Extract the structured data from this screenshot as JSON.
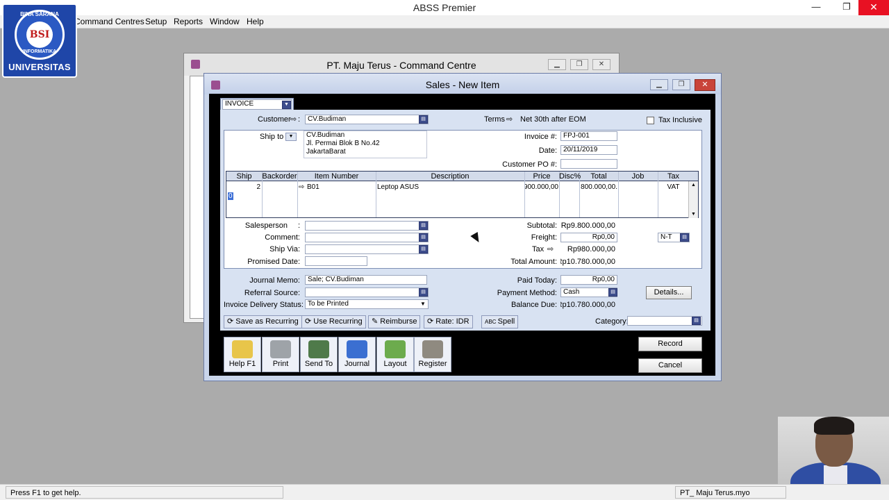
{
  "app": {
    "title": "ABSS Premier",
    "min": "—",
    "restore": "❐",
    "close": "✕"
  },
  "menu": [
    "Command Centres",
    "Setup",
    "Reports",
    "Window",
    "Help"
  ],
  "logo": {
    "arc_top": "BINA SARANA",
    "arc_bottom": "INFORMATIKA",
    "mark": "BSI",
    "label": "UNIVERSITAS"
  },
  "command_centre": {
    "title": "PT. Maju Terus - Command Centre"
  },
  "sales": {
    "title": "Sales - New Item",
    "layout_type": "INVOICE",
    "customer_label": "Customer",
    "customer": "CV.Budiman",
    "terms_label": "Terms",
    "terms": "Net 30th after EOM",
    "tax_inclusive_label": "Tax Inclusive",
    "ship_to_label": "Ship to",
    "ship_to_lines": [
      "CV.Budiman",
      "Jl. Permai Blok B No.42",
      "JakartaBarat"
    ],
    "invoice_no_label": "Invoice #:",
    "invoice_no": "FPJ-001",
    "date_label": "Date:",
    "date": "20/11/2019",
    "customer_po_label": "Customer PO #:",
    "customer_po": "",
    "grid": {
      "headers": [
        "Ship",
        "Backorder",
        "Item Number",
        "Description",
        "Price",
        "Disc%",
        "Total",
        "Job",
        "Tax"
      ],
      "row": {
        "ship": "2",
        "backorder": "",
        "item": "B01",
        "description": "Leptop ASUS",
        "price": "900.000,00",
        "disc": "",
        "total": ".800.000,00",
        "job": "",
        "tax": "VAT"
      },
      "next_ship": "0"
    },
    "salesperson_label": "Salesperson",
    "comment_label": "Comment:",
    "ship_via_label": "Ship Via:",
    "promised_date_label": "Promised Date:",
    "subtotal_label": "Subtotal:",
    "subtotal": "Rp9.800.000,00",
    "freight_label": "Freight:",
    "freight": "Rp0,00",
    "freight_tax": "N-T",
    "tax_label": "Tax",
    "tax": "Rp980.000,00",
    "total_label": "Total Amount:",
    "total": "Rp10.780.000,00",
    "journal_memo_label": "Journal Memo:",
    "journal_memo": "Sale; CV.Budiman",
    "referral_label": "Referral Source:",
    "delivery_label": "Invoice Delivery Status:",
    "delivery": "To be Printed",
    "paid_today_label": "Paid Today:",
    "paid_today": "Rp0,00",
    "payment_method_label": "Payment Method:",
    "payment_method": "Cash",
    "balance_due_label": "Balance Due:",
    "balance_due": "Rp10.780.000,00",
    "details_button": "Details...",
    "save_recurring": "Save as Recurring",
    "use_recurring": "Use Recurring",
    "reimburse": "Reimburse",
    "rate": "Rate:  IDR",
    "spell": "Spell",
    "category_label": "Category:",
    "tools": [
      "Help F1",
      "Print",
      "Send To",
      "Journal",
      "Layout",
      "Register"
    ],
    "record": "Record",
    "cancel": "Cancel"
  },
  "status": {
    "left": "Press F1 to get help.",
    "right": "PT_ Maju Terus.myo"
  }
}
